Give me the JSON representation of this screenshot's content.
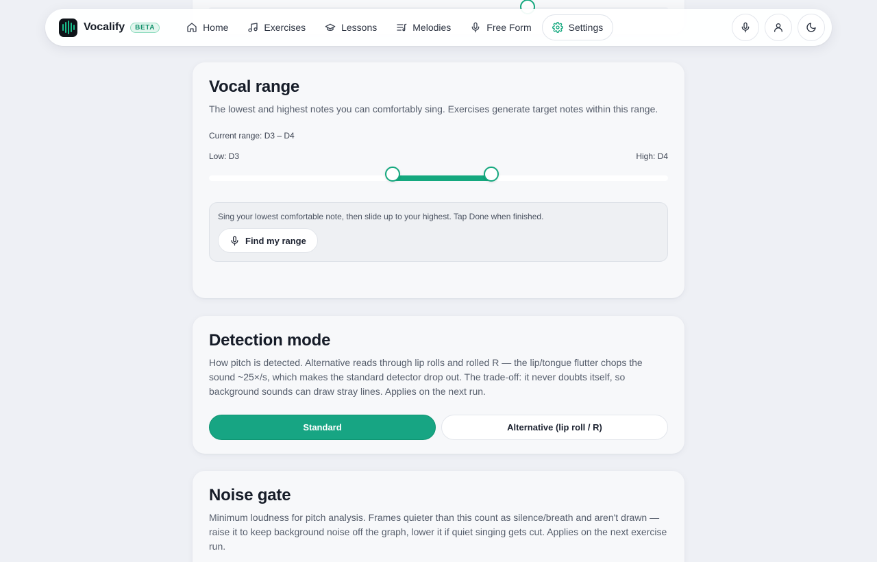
{
  "app": {
    "name": "Vocalify",
    "badge": "BETA"
  },
  "nav": {
    "items": [
      {
        "label": "Home",
        "icon": "home-icon"
      },
      {
        "label": "Exercises",
        "icon": "music-note-icon"
      },
      {
        "label": "Lessons",
        "icon": "graduation-cap-icon"
      },
      {
        "label": "Melodies",
        "icon": "playlist-icon"
      },
      {
        "label": "Free Form",
        "icon": "microphone-icon"
      },
      {
        "label": "Settings",
        "icon": "gear-icon",
        "active": true
      }
    ]
  },
  "header_actions": [
    "microphone-icon",
    "user-icon",
    "moon-icon"
  ],
  "vocal_range": {
    "title": "Vocal range",
    "description": "The lowest and highest notes you can comfortably sing. Exercises generate target notes within this range.",
    "current": "Current range: D3 – D4",
    "low_label": "Low: D3",
    "high_label": "High: D4",
    "low_fraction": 0.4,
    "high_fraction": 0.615,
    "hint": "Sing your lowest comfortable note, then slide up to your highest. Tap Done when finished.",
    "find_button": "Find my range"
  },
  "detection_mode": {
    "title": "Detection mode",
    "description": "How pitch is detected. Alternative reads through lip rolls and rolled R — the lip/tongue flutter chops the sound ~25×/s, which makes the standard detector drop out. The trade-off: it never doubts itself, so background sounds can draw stray lines. Applies on the next run.",
    "options": [
      "Standard",
      "Alternative (lip roll / R)"
    ],
    "selected": "Standard"
  },
  "noise_gate": {
    "title": "Noise gate",
    "description": "Minimum loudness for pitch analysis. Frames quieter than this count as silence/breath and aren't drawn — raise it to keep background noise off the graph, lower it if quiet singing gets cut. Applies on the next exercise run."
  },
  "colors": {
    "accent": "#14a87e",
    "background": "#eef0f5",
    "card": "#f7f8fa"
  }
}
